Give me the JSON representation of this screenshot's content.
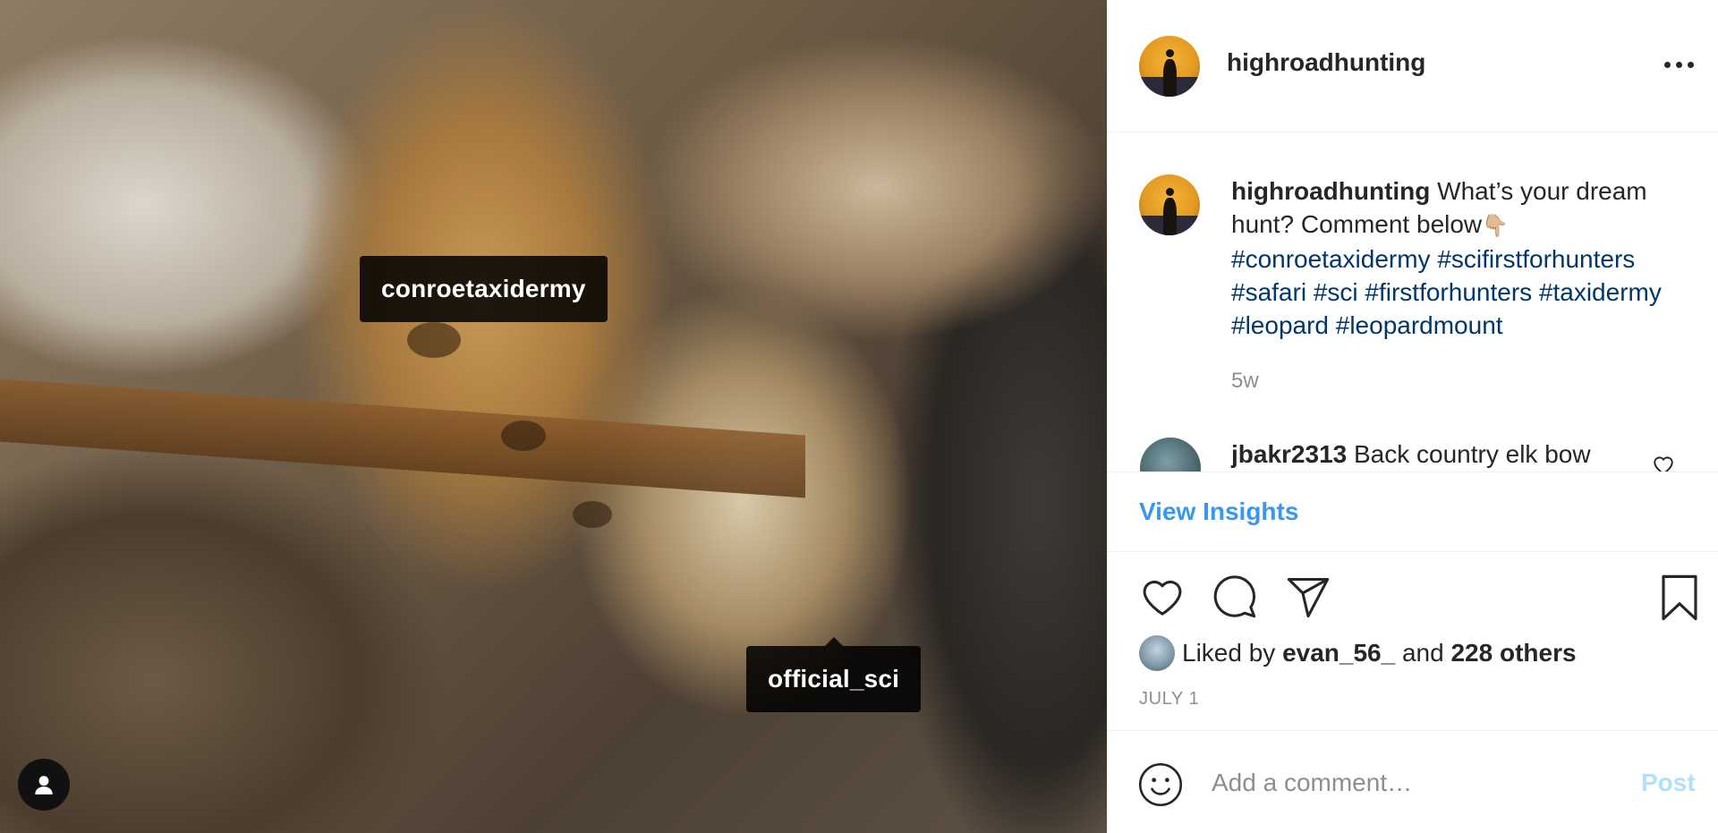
{
  "photo": {
    "tags": [
      "conroetaxidermy",
      "official_sci"
    ],
    "user_tag_icon": "person-icon"
  },
  "header": {
    "username": "highroadhunting",
    "more_icon": "more-options-icon"
  },
  "caption": {
    "username": "highroadhunting",
    "text": "What’s your dream hunt? Comment below",
    "emoji": "👇🏼",
    "hashtags": "#conroetaxidermy #scifirstforhunters #safari #sci #firstforhunters #taxidermy #leopard #leopardmount",
    "time": "5w"
  },
  "comment": {
    "username": "jbakr2313",
    "text": "Back country elk bow"
  },
  "insights": {
    "label": "View Insights"
  },
  "actions": {
    "icons": [
      "heart-icon",
      "comment-icon",
      "share-icon",
      "bookmark-icon"
    ]
  },
  "likes": {
    "prefix": "Liked by",
    "user": "evan_56_",
    "joiner": "and",
    "others": "228 others"
  },
  "date": "JULY 1",
  "add_comment": {
    "placeholder": "Add a comment…",
    "post_label": "Post"
  },
  "colors": {
    "link_blue": "#3897f0",
    "hashtag_blue": "#00376b",
    "post_disabled": "#b2dffc",
    "secondary_text": "#8e8e8e"
  }
}
